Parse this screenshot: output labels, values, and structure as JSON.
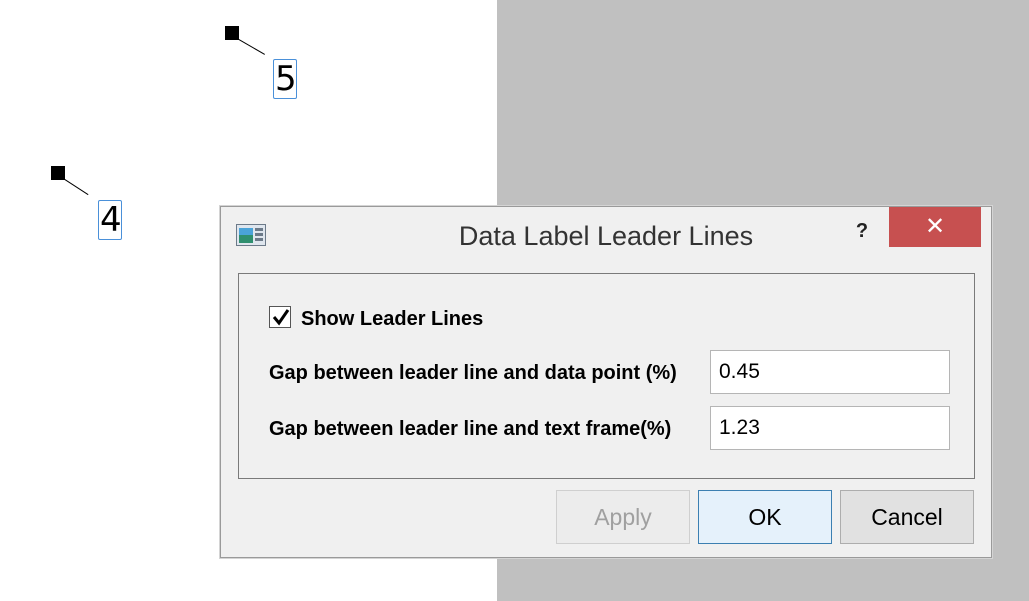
{
  "chart": {
    "labels": [
      "5",
      "4"
    ]
  },
  "dialog": {
    "title": "Data Label Leader Lines",
    "help": "?",
    "close": "✕",
    "show_leader_lines": {
      "label": "Show Leader Lines",
      "checked": true
    },
    "gap_data_point": {
      "label": "Gap between leader line and data point (%)",
      "value": "0.45"
    },
    "gap_text_frame": {
      "label": "Gap between leader line and text frame(%)",
      "value": "1.23"
    },
    "buttons": {
      "apply": "Apply",
      "ok": "OK",
      "cancel": "Cancel"
    }
  }
}
